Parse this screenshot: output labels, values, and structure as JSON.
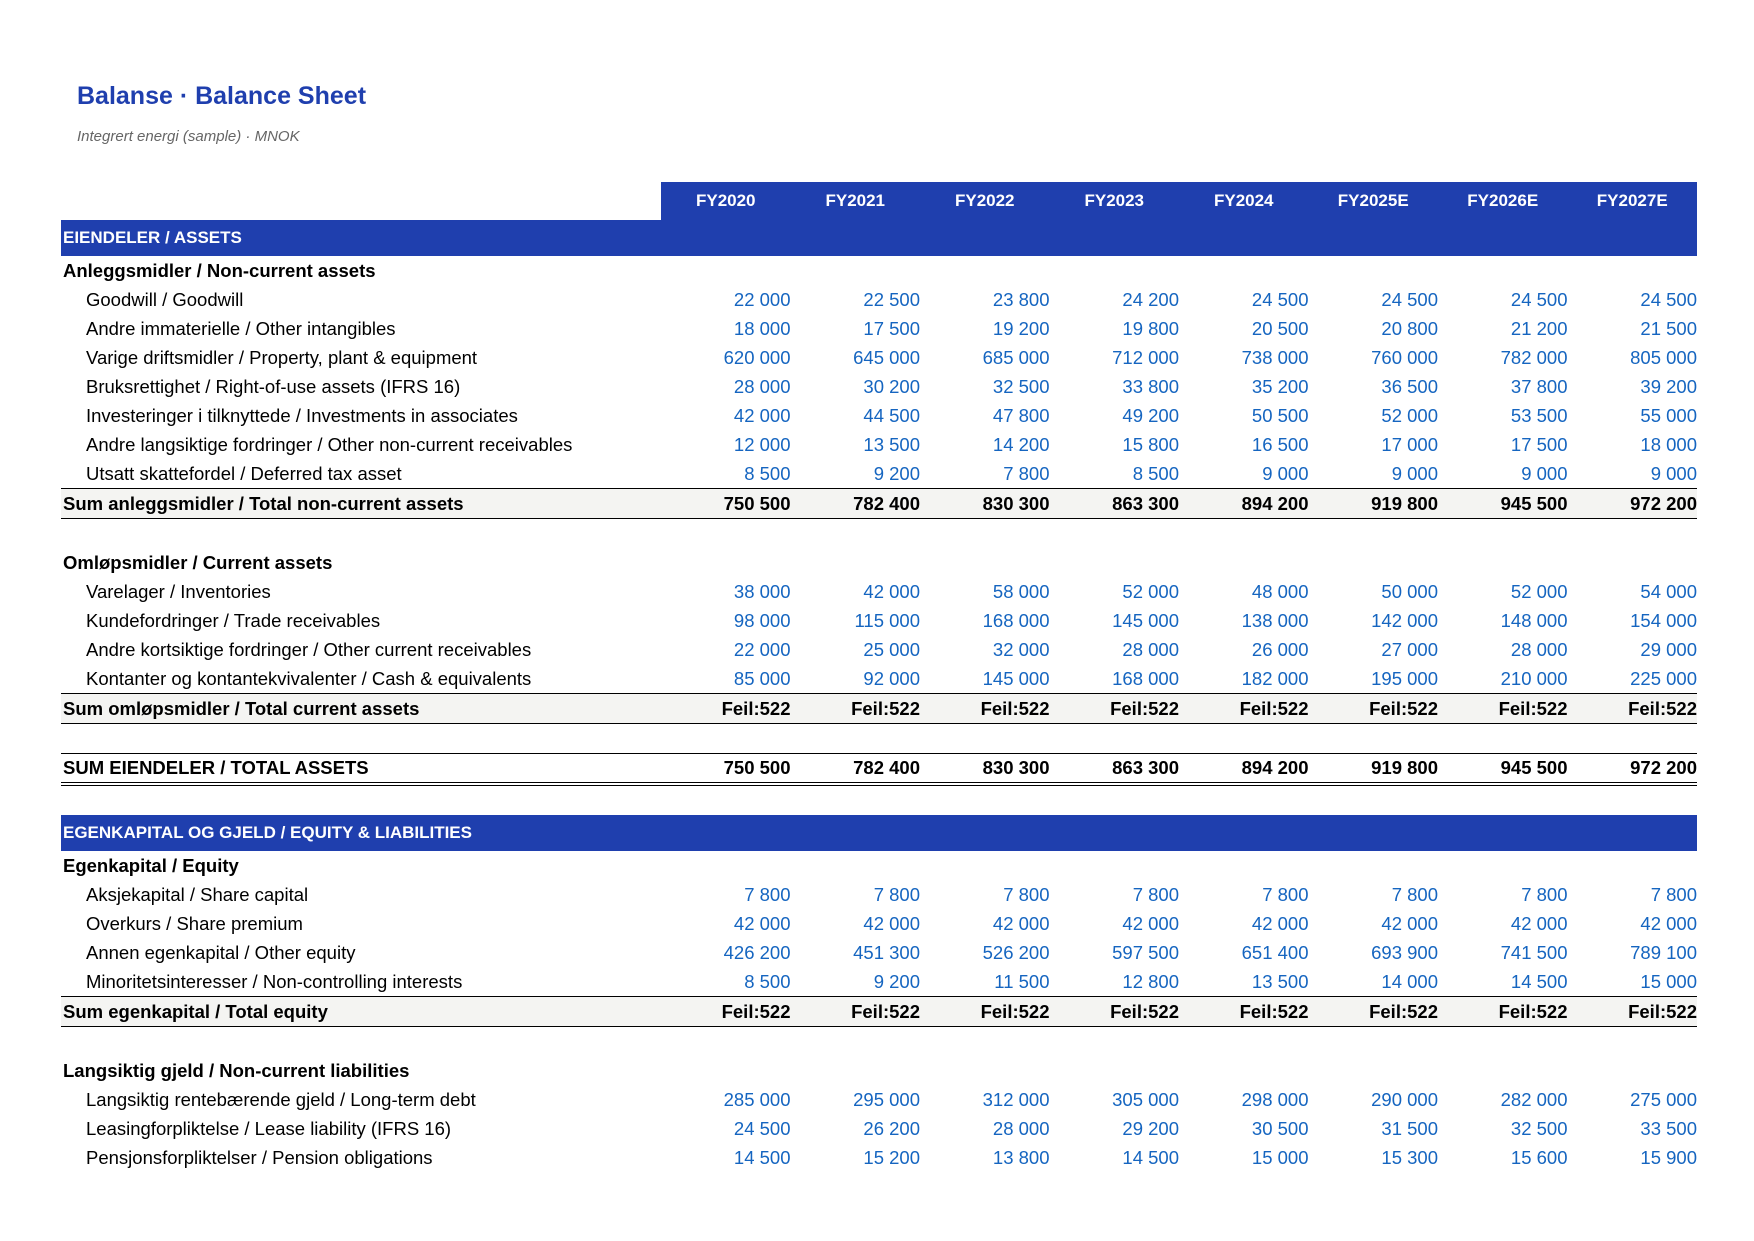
{
  "title": "Balanse · Balance Sheet",
  "subtitle": "Integrert energi (sample) · MNOK",
  "years": [
    "FY2020",
    "FY2021",
    "FY2022",
    "FY2023",
    "FY2024",
    "FY2025E",
    "FY2026E",
    "FY2027E"
  ],
  "assets": {
    "section": "EIENDELER / ASSETS",
    "noncurrent": {
      "heading": "Anleggsmidler / Non-current assets",
      "rows": [
        {
          "label": "Goodwill / Goodwill",
          "values": [
            "22 000",
            "22 500",
            "23 800",
            "24 200",
            "24 500",
            "24 500",
            "24 500",
            "24 500"
          ]
        },
        {
          "label": "Andre immaterielle / Other intangibles",
          "values": [
            "18 000",
            "17 500",
            "19 200",
            "19 800",
            "20 500",
            "20 800",
            "21 200",
            "21 500"
          ]
        },
        {
          "label": "Varige driftsmidler / Property, plant & equipment",
          "values": [
            "620 000",
            "645 000",
            "685 000",
            "712 000",
            "738 000",
            "760 000",
            "782 000",
            "805 000"
          ]
        },
        {
          "label": "Bruksrettighet / Right-of-use assets (IFRS 16)",
          "values": [
            "28 000",
            "30 200",
            "32 500",
            "33 800",
            "35 200",
            "36 500",
            "37 800",
            "39 200"
          ]
        },
        {
          "label": "Investeringer i tilknyttede / Investments in associates",
          "values": [
            "42 000",
            "44 500",
            "47 800",
            "49 200",
            "50 500",
            "52 000",
            "53 500",
            "55 000"
          ]
        },
        {
          "label": "Andre langsiktige fordringer / Other non-current receivables",
          "values": [
            "12 000",
            "13 500",
            "14 200",
            "15 800",
            "16 500",
            "17 000",
            "17 500",
            "18 000"
          ]
        },
        {
          "label": "Utsatt skattefordel / Deferred tax asset",
          "values": [
            "8 500",
            "9 200",
            "7 800",
            "8 500",
            "9 000",
            "9 000",
            "9 000",
            "9 000"
          ]
        }
      ],
      "total": {
        "label": "Sum anleggsmidler / Total non-current assets",
        "values": [
          "750 500",
          "782 400",
          "830 300",
          "863 300",
          "894 200",
          "919 800",
          "945 500",
          "972 200"
        ]
      }
    },
    "current": {
      "heading": "Omløpsmidler / Current assets",
      "rows": [
        {
          "label": "Varelager / Inventories",
          "values": [
            "38 000",
            "42 000",
            "58 000",
            "52 000",
            "48 000",
            "50 000",
            "52 000",
            "54 000"
          ]
        },
        {
          "label": "Kundefordringer / Trade receivables",
          "values": [
            "98 000",
            "115 000",
            "168 000",
            "145 000",
            "138 000",
            "142 000",
            "148 000",
            "154 000"
          ]
        },
        {
          "label": "Andre kortsiktige fordringer / Other current receivables",
          "values": [
            "22 000",
            "25 000",
            "32 000",
            "28 000",
            "26 000",
            "27 000",
            "28 000",
            "29 000"
          ]
        },
        {
          "label": "Kontanter og kontantekvivalenter / Cash & equivalents",
          "values": [
            "85 000",
            "92 000",
            "145 000",
            "168 000",
            "182 000",
            "195 000",
            "210 000",
            "225 000"
          ]
        }
      ],
      "total": {
        "label": "Sum omløpsmidler / Total current assets",
        "values": [
          "Feil:522",
          "Feil:522",
          "Feil:522",
          "Feil:522",
          "Feil:522",
          "Feil:522",
          "Feil:522",
          "Feil:522"
        ]
      }
    },
    "grand_total": {
      "label": "SUM EIENDELER / TOTAL ASSETS",
      "values": [
        "750 500",
        "782 400",
        "830 300",
        "863 300",
        "894 200",
        "919 800",
        "945 500",
        "972 200"
      ]
    }
  },
  "liabilities": {
    "section": "EGENKAPITAL OG GJELD / EQUITY & LIABILITIES",
    "equity": {
      "heading": "Egenkapital / Equity",
      "rows": [
        {
          "label": "Aksjekapital / Share capital",
          "values": [
            "7 800",
            "7 800",
            "7 800",
            "7 800",
            "7 800",
            "7 800",
            "7 800",
            "7 800"
          ]
        },
        {
          "label": "Overkurs / Share premium",
          "values": [
            "42 000",
            "42 000",
            "42 000",
            "42 000",
            "42 000",
            "42 000",
            "42 000",
            "42 000"
          ]
        },
        {
          "label": "Annen egenkapital / Other equity",
          "values": [
            "426 200",
            "451 300",
            "526 200",
            "597 500",
            "651 400",
            "693 900",
            "741 500",
            "789 100"
          ]
        },
        {
          "label": "Minoritetsinteresser / Non-controlling interests",
          "values": [
            "8 500",
            "9 200",
            "11 500",
            "12 800",
            "13 500",
            "14 000",
            "14 500",
            "15 000"
          ]
        }
      ],
      "total": {
        "label": "Sum egenkapital / Total equity",
        "values": [
          "Feil:522",
          "Feil:522",
          "Feil:522",
          "Feil:522",
          "Feil:522",
          "Feil:522",
          "Feil:522",
          "Feil:522"
        ]
      }
    },
    "noncurrent": {
      "heading": "Langsiktig gjeld / Non-current liabilities",
      "rows": [
        {
          "label": "Langsiktig rentebærende gjeld / Long-term debt",
          "values": [
            "285 000",
            "295 000",
            "312 000",
            "305 000",
            "298 000",
            "290 000",
            "282 000",
            "275 000"
          ]
        },
        {
          "label": "Leasingforpliktelse / Lease liability (IFRS 16)",
          "values": [
            "24 500",
            "26 200",
            "28 000",
            "29 200",
            "30 500",
            "31 500",
            "32 500",
            "33 500"
          ]
        },
        {
          "label": "Pensjonsforpliktelser / Pension obligations",
          "values": [
            "14 500",
            "15 200",
            "13 800",
            "14 500",
            "15 000",
            "15 300",
            "15 600",
            "15 900"
          ]
        }
      ]
    }
  }
}
